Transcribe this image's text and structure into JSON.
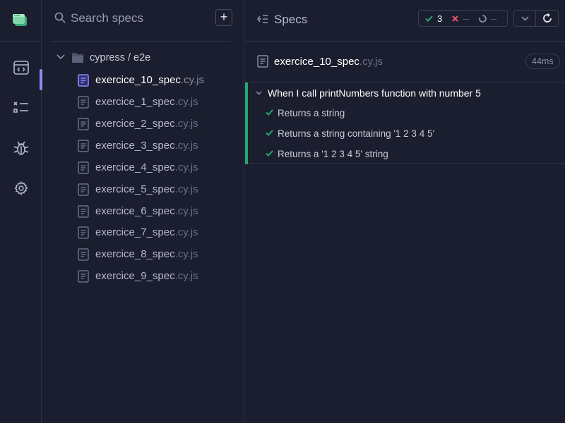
{
  "search": {
    "placeholder": "Search specs",
    "add_label": "+"
  },
  "folder": {
    "label": "cypress / e2e"
  },
  "files": [
    {
      "name": "exercice_10_spec",
      "ext": ".cy.js",
      "active": true
    },
    {
      "name": "exercice_1_spec",
      "ext": ".cy.js"
    },
    {
      "name": "exercice_2_spec",
      "ext": ".cy.js"
    },
    {
      "name": "exercice_3_spec",
      "ext": ".cy.js"
    },
    {
      "name": "exercice_4_spec",
      "ext": ".cy.js"
    },
    {
      "name": "exercice_5_spec",
      "ext": ".cy.js"
    },
    {
      "name": "exercice_6_spec",
      "ext": ".cy.js"
    },
    {
      "name": "exercice_7_spec",
      "ext": ".cy.js"
    },
    {
      "name": "exercice_8_spec",
      "ext": ".cy.js"
    },
    {
      "name": "exercice_9_spec",
      "ext": ".cy.js"
    }
  ],
  "runner": {
    "title": "Specs",
    "stats": {
      "passed": "3",
      "failed": "--",
      "pending": "--"
    },
    "spec": {
      "name": "exercice_10_spec",
      "ext": ".cy.js",
      "duration": "44ms"
    },
    "suite": {
      "title": "When I call printNumbers function with number 5",
      "tests": [
        "Returns a string",
        "Returns a string containing '1 2 3 4 5'",
        "Returns a '1 2 3 4 5' string"
      ]
    }
  },
  "colors": {
    "accent": "#8b8cf5",
    "pass": "#1fa971",
    "fail": "#e45770",
    "background": "#1b1e2e"
  }
}
